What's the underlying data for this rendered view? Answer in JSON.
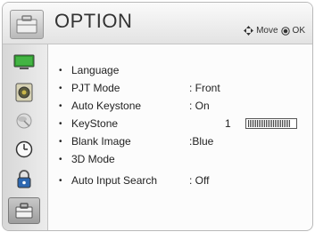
{
  "header": {
    "title": "OPTION",
    "hint_move": "Move",
    "hint_ok": "OK"
  },
  "sidebar": {
    "items": [
      {
        "icon": "monitor-icon"
      },
      {
        "icon": "speaker-icon"
      },
      {
        "icon": "satellite-dish-icon"
      },
      {
        "icon": "clock-icon"
      },
      {
        "icon": "lock-icon"
      },
      {
        "icon": "toolbox-icon",
        "selected": true
      }
    ]
  },
  "menu": {
    "bullet": "•",
    "items": [
      {
        "label": "Language",
        "value": ""
      },
      {
        "label": "PJT Mode",
        "value": ": Front"
      },
      {
        "label": "Auto Keystone",
        "value": ": On"
      },
      {
        "label": "KeyStone",
        "value": "1",
        "slider_level": 0.5
      },
      {
        "label": "Blank Image",
        "value": ":Blue"
      },
      {
        "label": "3D Mode",
        "value": ""
      },
      {
        "label": "Auto Input Search",
        "value": ": Off"
      }
    ]
  },
  "colors": {
    "accent_green": "#2f9a2f",
    "icon_blue": "#2d67b0"
  }
}
